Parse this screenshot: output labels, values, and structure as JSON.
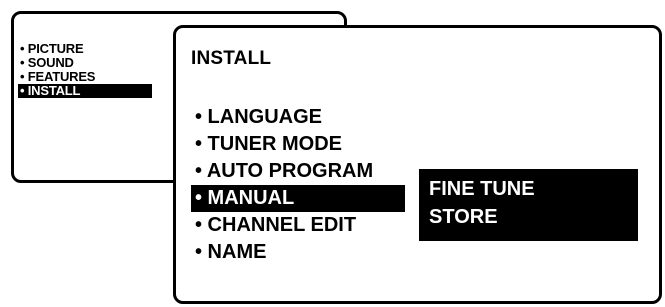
{
  "main_menu": {
    "items": [
      {
        "label": "• PICTURE",
        "selected": false
      },
      {
        "label": "• SOUND",
        "selected": false
      },
      {
        "label": "• FEATURES",
        "selected": false
      },
      {
        "label": "• INSTALL",
        "selected": true
      }
    ]
  },
  "install_menu": {
    "title": "INSTALL",
    "items": [
      {
        "label": "• LANGUAGE",
        "selected": false
      },
      {
        "label": "• TUNER MODE",
        "selected": false
      },
      {
        "label": "• AUTO PROGRAM",
        "selected": false
      },
      {
        "label": "• MANUAL",
        "selected": true
      },
      {
        "label": "• CHANNEL EDIT",
        "selected": false
      },
      {
        "label": "• NAME",
        "selected": false
      }
    ]
  },
  "manual_submenu": {
    "items": [
      {
        "label": "FINE TUNE"
      },
      {
        "label": "STORE"
      }
    ]
  },
  "colors": {
    "background": "#ffffff",
    "highlight": "#000000",
    "highlight_text": "#ffffff"
  }
}
